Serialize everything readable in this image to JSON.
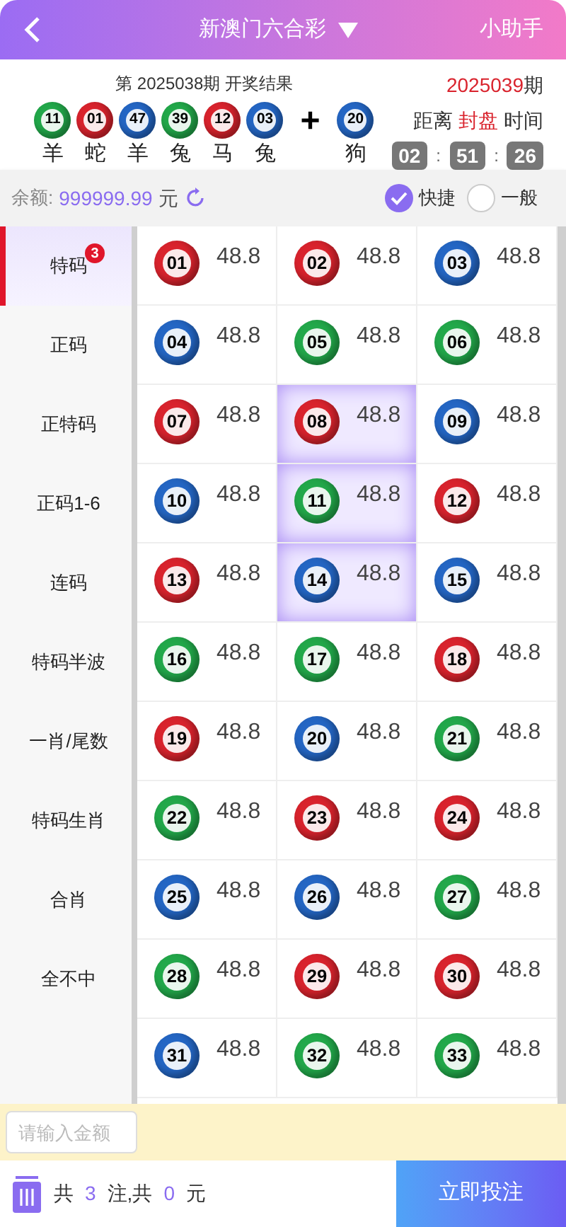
{
  "header": {
    "title": "新澳门六合彩",
    "helper": "小助手"
  },
  "last_draw": {
    "caption": "第 2025038期 开奖结果",
    "plus": "+",
    "balls": [
      {
        "number": "11",
        "color": "#22a84a",
        "zodiac": "羊"
      },
      {
        "number": "01",
        "color": "#d9232d",
        "zodiac": "蛇"
      },
      {
        "number": "47",
        "color": "#2466c4",
        "zodiac": "羊"
      },
      {
        "number": "39",
        "color": "#22a84a",
        "zodiac": "兔"
      },
      {
        "number": "12",
        "color": "#d9232d",
        "zodiac": "马"
      },
      {
        "number": "03",
        "color": "#2466c4",
        "zodiac": "兔"
      }
    ],
    "special": {
      "number": "20",
      "color": "#2466c4",
      "zodiac": "狗"
    }
  },
  "next_draw": {
    "period": "2025039",
    "period_suffix": "期",
    "label_before": "距离",
    "label_mid": "封盘",
    "label_after": "时间",
    "countdown": [
      "02",
      "51",
      "26"
    ],
    "separator": ":"
  },
  "balance": {
    "label": "余额:",
    "amount": "999999.99",
    "unit": "元"
  },
  "modes": [
    {
      "label": "快捷",
      "selected": true
    },
    {
      "label": "一般",
      "selected": false
    }
  ],
  "categories": [
    {
      "label": "特码",
      "selected": true,
      "badge": "3"
    },
    {
      "label": "正码",
      "selected": false
    },
    {
      "label": "正特码",
      "selected": false
    },
    {
      "label": "正码1-6",
      "selected": false
    },
    {
      "label": "连码",
      "selected": false
    },
    {
      "label": "特码半波",
      "selected": false
    },
    {
      "label": "一肖/尾数",
      "selected": false
    },
    {
      "label": "特码生肖",
      "selected": false
    },
    {
      "label": "合肖",
      "selected": false
    },
    {
      "label": "全不中",
      "selected": false
    }
  ],
  "numbers": [
    {
      "number": "01",
      "odds": "48.8",
      "color": "#d9232d",
      "selected": false
    },
    {
      "number": "02",
      "odds": "48.8",
      "color": "#d9232d",
      "selected": false
    },
    {
      "number": "03",
      "odds": "48.8",
      "color": "#2466c4",
      "selected": false
    },
    {
      "number": "04",
      "odds": "48.8",
      "color": "#2466c4",
      "selected": false
    },
    {
      "number": "05",
      "odds": "48.8",
      "color": "#22a84a",
      "selected": false
    },
    {
      "number": "06",
      "odds": "48.8",
      "color": "#22a84a",
      "selected": false
    },
    {
      "number": "07",
      "odds": "48.8",
      "color": "#d9232d",
      "selected": false
    },
    {
      "number": "08",
      "odds": "48.8",
      "color": "#d9232d",
      "selected": true
    },
    {
      "number": "09",
      "odds": "48.8",
      "color": "#2466c4",
      "selected": false
    },
    {
      "number": "10",
      "odds": "48.8",
      "color": "#2466c4",
      "selected": false
    },
    {
      "number": "11",
      "odds": "48.8",
      "color": "#22a84a",
      "selected": true
    },
    {
      "number": "12",
      "odds": "48.8",
      "color": "#d9232d",
      "selected": false
    },
    {
      "number": "13",
      "odds": "48.8",
      "color": "#d9232d",
      "selected": false
    },
    {
      "number": "14",
      "odds": "48.8",
      "color": "#2466c4",
      "selected": true
    },
    {
      "number": "15",
      "odds": "48.8",
      "color": "#2466c4",
      "selected": false
    },
    {
      "number": "16",
      "odds": "48.8",
      "color": "#22a84a",
      "selected": false
    },
    {
      "number": "17",
      "odds": "48.8",
      "color": "#22a84a",
      "selected": false
    },
    {
      "number": "18",
      "odds": "48.8",
      "color": "#d9232d",
      "selected": false
    },
    {
      "number": "19",
      "odds": "48.8",
      "color": "#d9232d",
      "selected": false
    },
    {
      "number": "20",
      "odds": "48.8",
      "color": "#2466c4",
      "selected": false
    },
    {
      "number": "21",
      "odds": "48.8",
      "color": "#22a84a",
      "selected": false
    },
    {
      "number": "22",
      "odds": "48.8",
      "color": "#22a84a",
      "selected": false
    },
    {
      "number": "23",
      "odds": "48.8",
      "color": "#d9232d",
      "selected": false
    },
    {
      "number": "24",
      "odds": "48.8",
      "color": "#d9232d",
      "selected": false
    },
    {
      "number": "25",
      "odds": "48.8",
      "color": "#2466c4",
      "selected": false
    },
    {
      "number": "26",
      "odds": "48.8",
      "color": "#2466c4",
      "selected": false
    },
    {
      "number": "27",
      "odds": "48.8",
      "color": "#22a84a",
      "selected": false
    },
    {
      "number": "28",
      "odds": "48.8",
      "color": "#22a84a",
      "selected": false
    },
    {
      "number": "29",
      "odds": "48.8",
      "color": "#d9232d",
      "selected": false
    },
    {
      "number": "30",
      "odds": "48.8",
      "color": "#d9232d",
      "selected": false
    },
    {
      "number": "31",
      "odds": "48.8",
      "color": "#2466c4",
      "selected": false
    },
    {
      "number": "32",
      "odds": "48.8",
      "color": "#22a84a",
      "selected": false
    },
    {
      "number": "33",
      "odds": "48.8",
      "color": "#22a84a",
      "selected": false
    }
  ],
  "amount_field": {
    "placeholder": "请输入金额"
  },
  "summary": {
    "prefix": "共",
    "count": "3",
    "middle": "注,共",
    "total": "0",
    "suffix": "元"
  },
  "submit": "立即投注"
}
